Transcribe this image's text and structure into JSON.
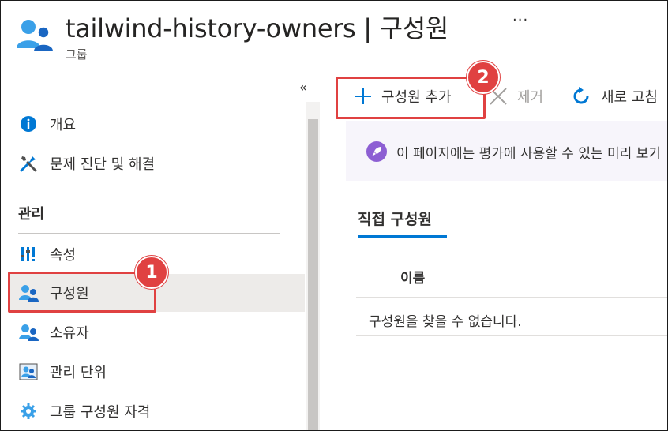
{
  "header": {
    "title": "tailwind-history-owners | 구성원",
    "subtitle": "그룹",
    "more_label": "···",
    "icon": "group-icon"
  },
  "sidebar": {
    "collapse_label": "«",
    "items_top": [
      {
        "label": "개요",
        "icon": "info-icon"
      },
      {
        "label": "문제 진단 및 해결",
        "icon": "wrench-icon"
      }
    ],
    "section_label": "관리",
    "items_manage": [
      {
        "label": "속성",
        "icon": "properties-icon"
      },
      {
        "label": "구성원",
        "icon": "members-icon",
        "selected": true
      },
      {
        "label": "소유자",
        "icon": "owners-icon"
      },
      {
        "label": "관리 단위",
        "icon": "admin-units-icon"
      },
      {
        "label": "그룹 구성원 자격",
        "icon": "group-membership-icon"
      }
    ]
  },
  "toolbar": {
    "add_label": "구성원 추가",
    "remove_label": "제거",
    "refresh_label": "새로 고침"
  },
  "banner": {
    "text": "이 페이지에는 평가에 사용할 수 있는 미리 보기"
  },
  "content": {
    "tab_label": "직접 구성원",
    "column_name": "이름",
    "empty_message": "구성원을 찾을 수 없습니다."
  },
  "callouts": {
    "one": "1",
    "two": "2"
  },
  "colors": {
    "accent": "#0078d4",
    "callout": "#e04141",
    "selected_bg": "#edebe9",
    "banner_bg": "#f7f5fb"
  }
}
